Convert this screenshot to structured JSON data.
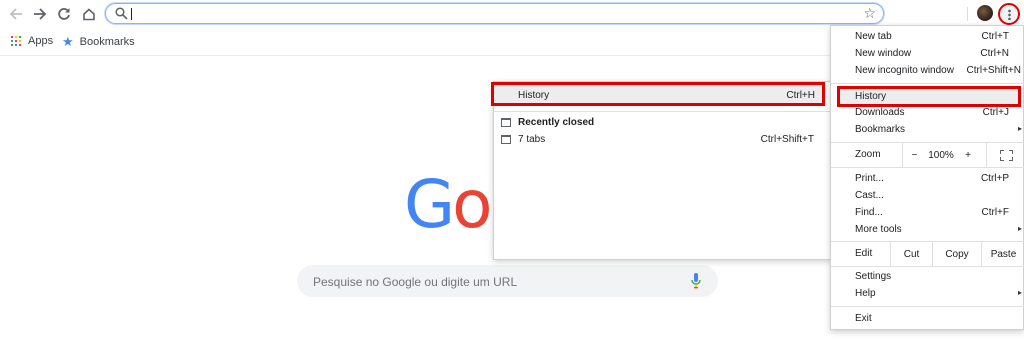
{
  "toolbar": {
    "back_icon": "arrow-left-icon",
    "forward_icon": "arrow-right-icon",
    "reload_icon": "reload-icon",
    "home_icon": "home-icon",
    "omnibox_value": "",
    "bookmark_star_icon": "star-outline-icon",
    "menu_icon": "three-dots-vertical-icon"
  },
  "bookmarks_bar": {
    "apps_label": "Apps",
    "bookmarks_label": "Bookmarks"
  },
  "ntp": {
    "logo_g": "G",
    "logo_o": "o",
    "search_placeholder": "Pesquise no Google ou digite um URL"
  },
  "history_submenu": {
    "history": {
      "label": "History",
      "shortcut": "Ctrl+H"
    },
    "recently_closed": "Recently closed",
    "tabs_item": {
      "label": "7 tabs",
      "shortcut": "Ctrl+Shift+T"
    }
  },
  "menu": {
    "new_tab": {
      "label": "New tab",
      "shortcut": "Ctrl+T"
    },
    "new_window": {
      "label": "New window",
      "shortcut": "Ctrl+N"
    },
    "new_incognito": {
      "label": "New incognito window",
      "shortcut": "Ctrl+Shift+N"
    },
    "history": {
      "label": "History"
    },
    "downloads": {
      "label": "Downloads",
      "shortcut": "Ctrl+J"
    },
    "bookmarks": {
      "label": "Bookmarks"
    },
    "zoom": {
      "label": "Zoom",
      "minus": "−",
      "value": "100%",
      "plus": "+"
    },
    "print": {
      "label": "Print...",
      "shortcut": "Ctrl+P"
    },
    "cast": {
      "label": "Cast..."
    },
    "find": {
      "label": "Find...",
      "shortcut": "Ctrl+F"
    },
    "more_tools": {
      "label": "More tools"
    },
    "edit": {
      "label": "Edit",
      "cut": "Cut",
      "copy": "Copy",
      "paste": "Paste"
    },
    "settings": {
      "label": "Settings"
    },
    "help": {
      "label": "Help"
    },
    "exit": {
      "label": "Exit"
    },
    "submenu_arrow": "▸"
  },
  "colors": {
    "highlight_red": "#e00000",
    "google_blue": "#4285f4",
    "google_red": "#ea4335",
    "google_yellow": "#fbbc05",
    "google_green": "#34a853"
  }
}
